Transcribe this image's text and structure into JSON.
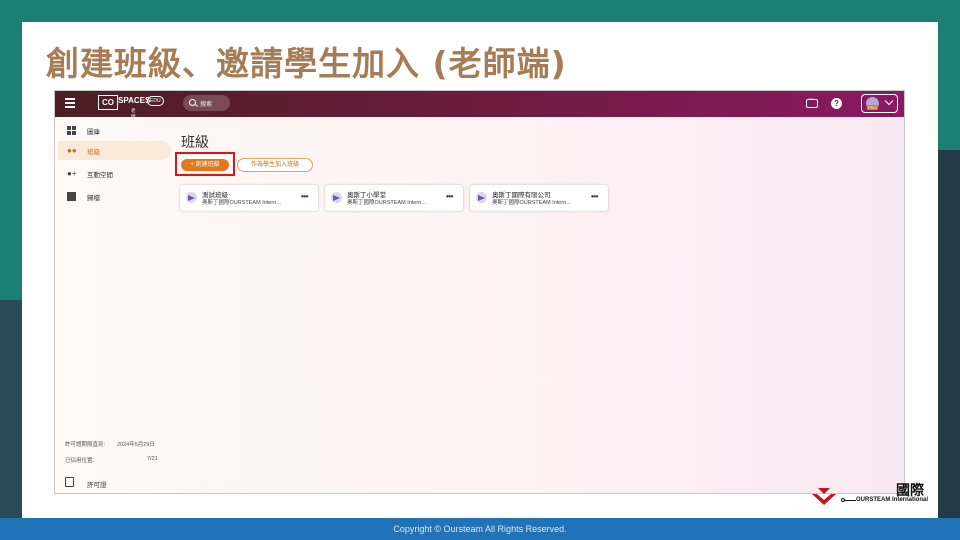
{
  "slide": {
    "title": "創建班級、邀請學生加入 (老師端)",
    "footer": "Copyright © Oursteam All Rights Reserved.",
    "brand_zh": "國際",
    "brand_en": "OURSTEAM International"
  },
  "topbar": {
    "logo_box": "CO",
    "logo_text": "SPACES",
    "logo_edu": "EDU",
    "logo_sub": "老師",
    "search_placeholder": "搜索",
    "help_label": "?",
    "pro_badge": "PRO"
  },
  "sidebar": {
    "items": [
      {
        "label": "圖庫",
        "icon": "grid-icon"
      },
      {
        "label": "班級",
        "icon": "people-icon",
        "active": true
      },
      {
        "label": "互動空間",
        "icon": "people-add-icon"
      },
      {
        "label": "歸檔",
        "icon": "archive-icon"
      }
    ],
    "license_until_label": "許可證期限直到:",
    "license_until_value": "2024年5月29日",
    "seats_label": "已佔用位置：",
    "seats_value": "7/21",
    "license_link": "許可證"
  },
  "main": {
    "heading": "班級",
    "create_button": "+ 創建班級",
    "join_button": "作為學生加入班級",
    "classes": [
      {
        "name": "測試班級",
        "org": "奧斯丁國際OURSTEAM Intern..."
      },
      {
        "name": "奧斯丁小學堂",
        "org": "奧斯丁國際OURSTEAM Intern..."
      },
      {
        "name": "奧斯丁國際有限公司",
        "org": "奧斯丁國際OURSTEAM Intern..."
      }
    ],
    "more_label": "•••"
  },
  "colors": {
    "accent": "#e2771c",
    "title": "#a57c55",
    "highlight": "#d9141f",
    "topbar_start": "#4b1f22",
    "topbar_end": "#8a1a63"
  }
}
